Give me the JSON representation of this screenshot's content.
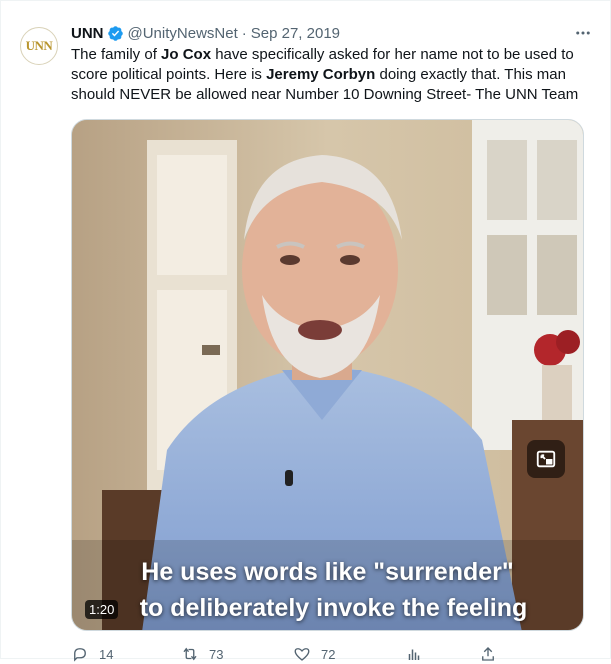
{
  "tweet": {
    "avatar_logo": "UNN",
    "name": "UNN",
    "handle": "@UnityNewsNet",
    "separator": "·",
    "date": "Sep 27, 2019",
    "text": {
      "p1": "The family of ",
      "b1": "Jo Cox",
      "p2": " have specifically asked for her name not to be used to score political points. Here is ",
      "b2": "Jeremy Corbyn",
      "p3": " doing exactly that. This man should NEVER be allowed near Number 10 Downing Street- The UNN Team"
    },
    "media": {
      "caption_line1": "He uses words like \"surrender\"",
      "caption_line2": "to deliberately invoke the feeling",
      "duration": "1:20"
    },
    "actions": {
      "replies": "14",
      "retweets": "73",
      "likes": "72"
    }
  },
  "colors": {
    "verified": "#1d9bf0",
    "muted": "#536471",
    "text": "#0f1419"
  },
  "icons": [
    "verified-badge-icon",
    "more-icon",
    "pip-icon",
    "reply-icon",
    "retweet-icon",
    "like-icon",
    "views-icon",
    "share-icon"
  ]
}
